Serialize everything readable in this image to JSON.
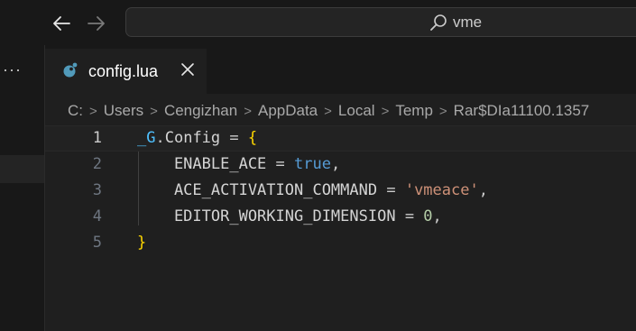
{
  "titlebar": {
    "back_icon": "arrow-left-icon",
    "forward_icon": "arrow-right-icon",
    "search": {
      "icon": "search-icon",
      "text": "vme"
    }
  },
  "activity_bar": {
    "more_label": "···"
  },
  "tab": {
    "label": "config.lua",
    "icon": "lua-file-icon",
    "close_icon": "close-icon"
  },
  "breadcrumb": [
    "C:",
    "Users",
    "Cengizhan",
    "AppData",
    "Local",
    "Temp",
    "Rar$DIa11100.1357"
  ],
  "editor": {
    "lines": [
      {
        "number": "1",
        "tokens": [
          {
            "t": "_G",
            "c": "global"
          },
          {
            "t": ".",
            "c": "punct"
          },
          {
            "t": "Config",
            "c": "field"
          },
          {
            "t": " = ",
            "c": "punct"
          },
          {
            "t": "{",
            "c": "brace"
          }
        ]
      },
      {
        "number": "2",
        "tokens": [
          {
            "t": "    ENABLE_ACE",
            "c": "key"
          },
          {
            "t": " = ",
            "c": "punct"
          },
          {
            "t": "true",
            "c": "bool"
          },
          {
            "t": ",",
            "c": "punct"
          }
        ]
      },
      {
        "number": "3",
        "tokens": [
          {
            "t": "    ACE_ACTIVATION_COMMAND",
            "c": "key"
          },
          {
            "t": " = ",
            "c": "punct"
          },
          {
            "t": "'vmeace'",
            "c": "str"
          },
          {
            "t": ",",
            "c": "punct"
          }
        ]
      },
      {
        "number": "4",
        "tokens": [
          {
            "t": "    EDITOR_WORKING_DIMENSION",
            "c": "key"
          },
          {
            "t": " = ",
            "c": "punct"
          },
          {
            "t": "0",
            "c": "num"
          },
          {
            "t": ",",
            "c": "punct"
          }
        ]
      },
      {
        "number": "5",
        "tokens": [
          {
            "t": "}",
            "c": "brace"
          }
        ]
      }
    ],
    "active_line": 1
  }
}
